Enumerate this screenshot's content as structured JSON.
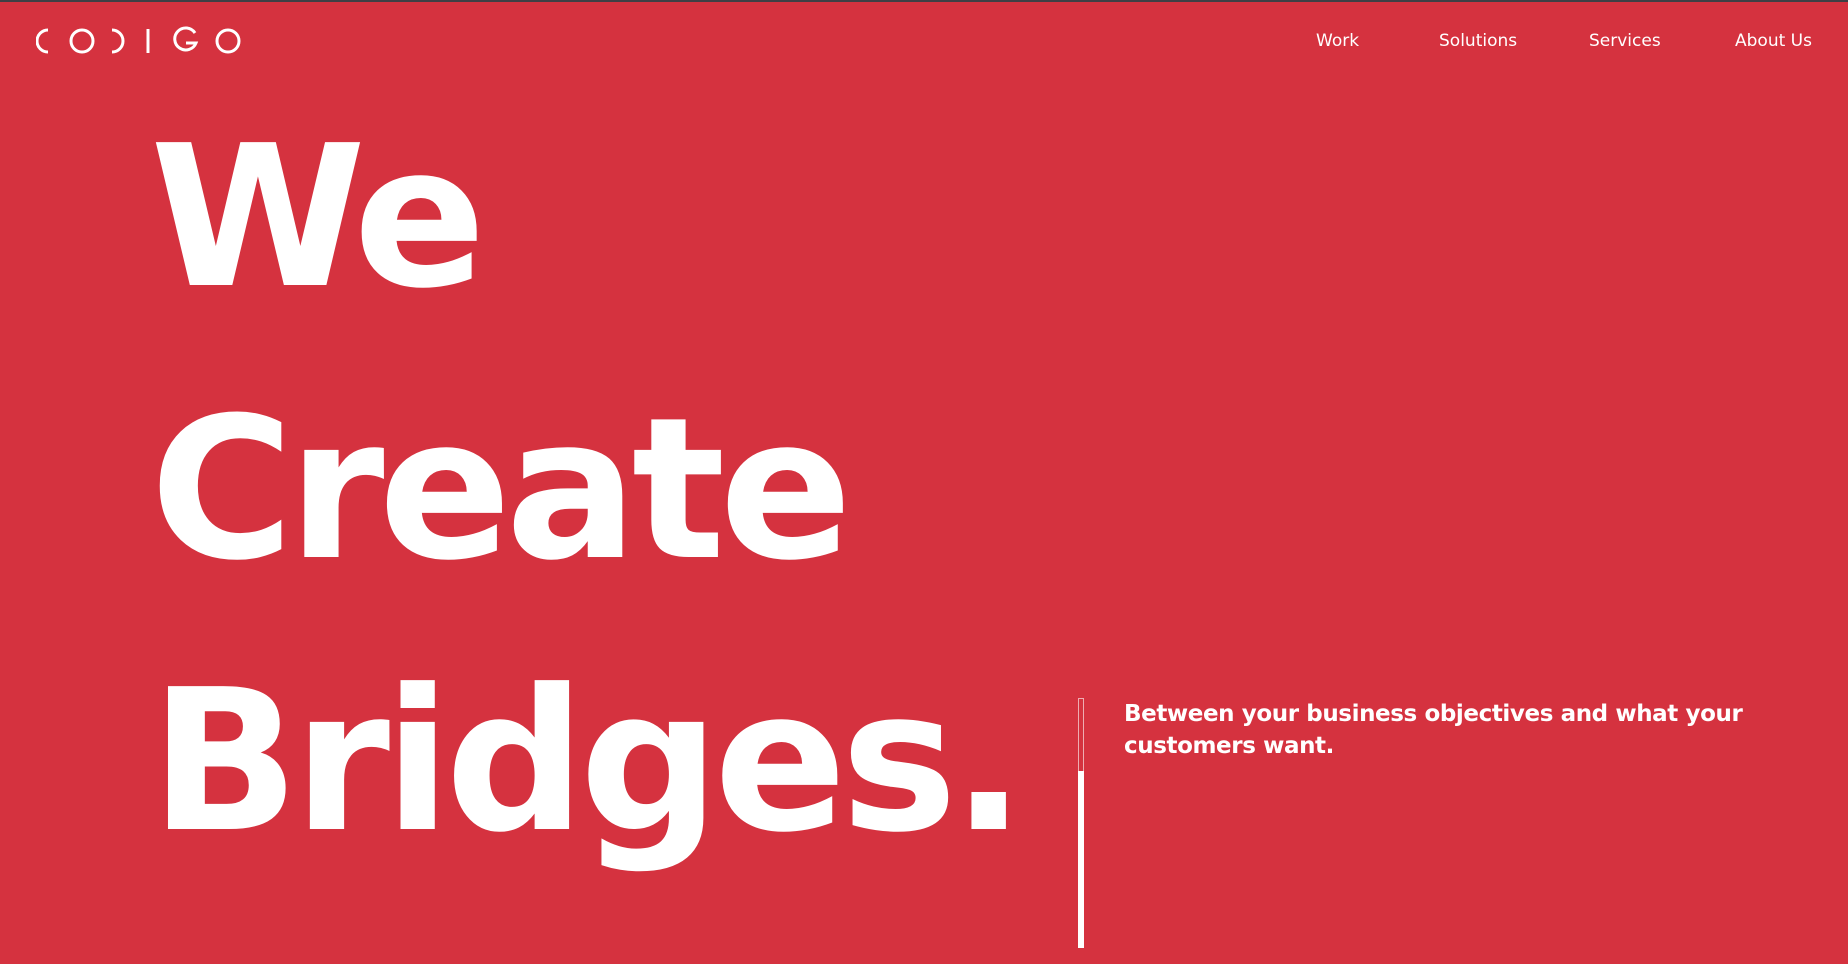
{
  "theme": {
    "background": "#d5323f",
    "text": "#ffffff",
    "topline": "#3f3f45"
  },
  "header": {
    "logo_text": "CODIGO",
    "logo_icon": "codigo-logo-icon",
    "nav": [
      {
        "label": "Work"
      },
      {
        "label": "Solutions"
      },
      {
        "label": "Services"
      },
      {
        "label": "About Us"
      }
    ]
  },
  "hero": {
    "lines": [
      "We",
      "Create",
      "Bridges."
    ],
    "tagline": "Between your business objectives and what your customers want."
  },
  "scroll_indicator": {
    "progress": 0.35
  }
}
